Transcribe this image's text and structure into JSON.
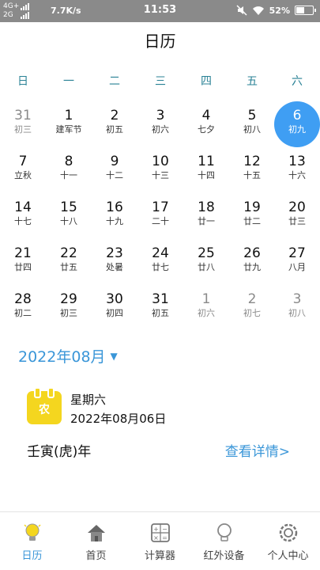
{
  "status_bar": {
    "network_top": "4G+",
    "network_bottom": "2G",
    "speed": "7.7K/s",
    "time": "11:53",
    "battery": "52%",
    "battery_level": 0.52
  },
  "header": {
    "title": "日历"
  },
  "weekdays": [
    "日",
    "一",
    "二",
    "三",
    "四",
    "五",
    "六"
  ],
  "calendar": {
    "rows": [
      [
        {
          "day": "31",
          "lunar": "初三",
          "other": true
        },
        {
          "day": "1",
          "lunar": "建军节"
        },
        {
          "day": "2",
          "lunar": "初五"
        },
        {
          "day": "3",
          "lunar": "初六"
        },
        {
          "day": "4",
          "lunar": "七夕"
        },
        {
          "day": "5",
          "lunar": "初八"
        },
        {
          "day": "6",
          "lunar": "初九",
          "selected": true
        }
      ],
      [
        {
          "day": "7",
          "lunar": "立秋"
        },
        {
          "day": "8",
          "lunar": "十一"
        },
        {
          "day": "9",
          "lunar": "十二"
        },
        {
          "day": "10",
          "lunar": "十三"
        },
        {
          "day": "11",
          "lunar": "十四"
        },
        {
          "day": "12",
          "lunar": "十五"
        },
        {
          "day": "13",
          "lunar": "十六"
        }
      ],
      [
        {
          "day": "14",
          "lunar": "十七"
        },
        {
          "day": "15",
          "lunar": "十八"
        },
        {
          "day": "16",
          "lunar": "十九"
        },
        {
          "day": "17",
          "lunar": "二十"
        },
        {
          "day": "18",
          "lunar": "廿一"
        },
        {
          "day": "19",
          "lunar": "廿二"
        },
        {
          "day": "20",
          "lunar": "廿三"
        }
      ],
      [
        {
          "day": "21",
          "lunar": "廿四"
        },
        {
          "day": "22",
          "lunar": "廿五"
        },
        {
          "day": "23",
          "lunar": "处暑"
        },
        {
          "day": "24",
          "lunar": "廿七"
        },
        {
          "day": "25",
          "lunar": "廿八"
        },
        {
          "day": "26",
          "lunar": "廿九"
        },
        {
          "day": "27",
          "lunar": "八月"
        }
      ],
      [
        {
          "day": "28",
          "lunar": "初二"
        },
        {
          "day": "29",
          "lunar": "初三"
        },
        {
          "day": "30",
          "lunar": "初四"
        },
        {
          "day": "31",
          "lunar": "初五"
        },
        {
          "day": "1",
          "lunar": "初六",
          "other": true
        },
        {
          "day": "2",
          "lunar": "初七",
          "other": true
        },
        {
          "day": "3",
          "lunar": "初八",
          "other": true
        }
      ]
    ]
  },
  "month_selector": {
    "label": "2022年08月",
    "arrow": "▼"
  },
  "selected_info": {
    "icon_glyph": "农",
    "weekday": "星期六",
    "date": "2022年08月06日",
    "ganzhi": "壬寅(虎)年",
    "details_link": "查看详情>"
  },
  "colors": {
    "accent": "#3a96d8",
    "selected_circle": "#3f9ef3",
    "weekday_header": "#2a8296",
    "icon_yellow": "#f4d61f"
  },
  "tabs": [
    {
      "label": "日历",
      "icon": "lightbulb-icon",
      "active": true
    },
    {
      "label": "首页",
      "icon": "home-icon"
    },
    {
      "label": "计算器",
      "icon": "calculator-icon"
    },
    {
      "label": "红外设备",
      "icon": "bulb-outline-icon"
    },
    {
      "label": "个人中心",
      "icon": "gear-icon"
    }
  ]
}
